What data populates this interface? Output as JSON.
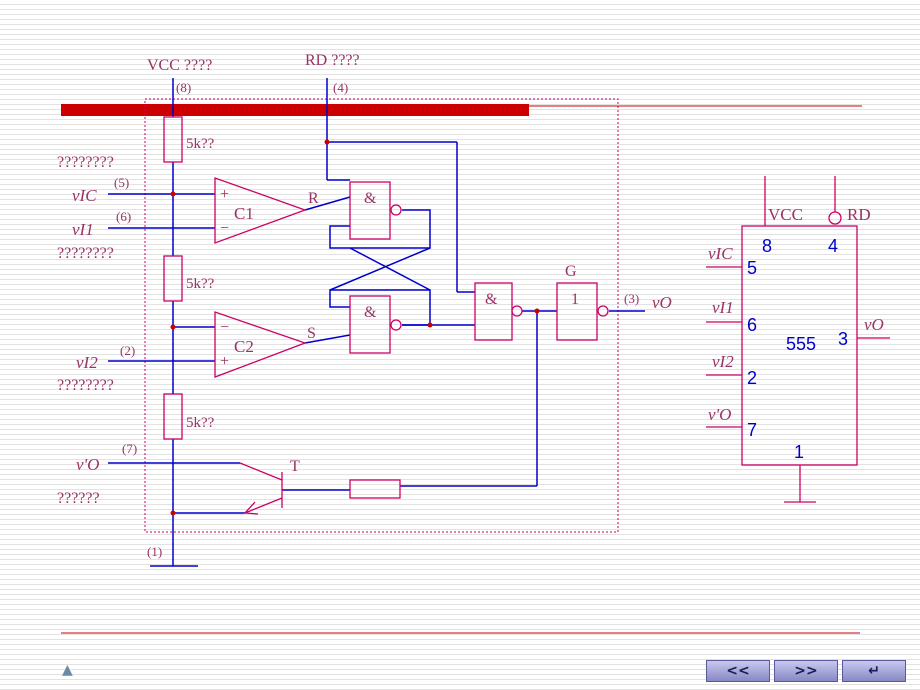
{
  "labels": {
    "vcc_top": "VCC ????",
    "rd_top": "RD ????",
    "pin8": "(8)",
    "pin4": "(4)",
    "pin5": "(5)",
    "pin6": "(6)",
    "pin2": "(2)",
    "pin7": "(7)",
    "pin1": "(1)",
    "pin3": "(3)",
    "res1": "5k??",
    "res2": "5k??",
    "res3": "5k??",
    "note1": "????????",
    "note2": "????????",
    "note3": "????????",
    "note4": "??????",
    "vic": "vIC",
    "vi1": "vI1",
    "vi2": "vI2",
    "vo_prime": "v'O",
    "vo": "vO",
    "R": "R",
    "S": "S",
    "T": "T",
    "G": "G",
    "c1": "C1",
    "c2": "C2",
    "plus": "+",
    "minus": "−",
    "and": "&",
    "one": "1"
  },
  "chip": {
    "name": "555",
    "vcc": "VCC",
    "rd": "RD",
    "vic": "vIC",
    "vi1": "vI1",
    "vi2": "vI2",
    "vo_prime": "v'O",
    "vo": "vO",
    "p8": "8",
    "p4": "4",
    "p5": "5",
    "p6": "6",
    "p3": "3",
    "p2": "2",
    "p7": "7",
    "p1": "1"
  },
  "nav": {
    "prev": "<<",
    "next": ">>",
    "back": "↵",
    "home_icon": "home-icon"
  },
  "colors": {
    "wire": "#0000cc",
    "component": "#cc0066",
    "text": "#993366",
    "bar": "#cc0000"
  }
}
